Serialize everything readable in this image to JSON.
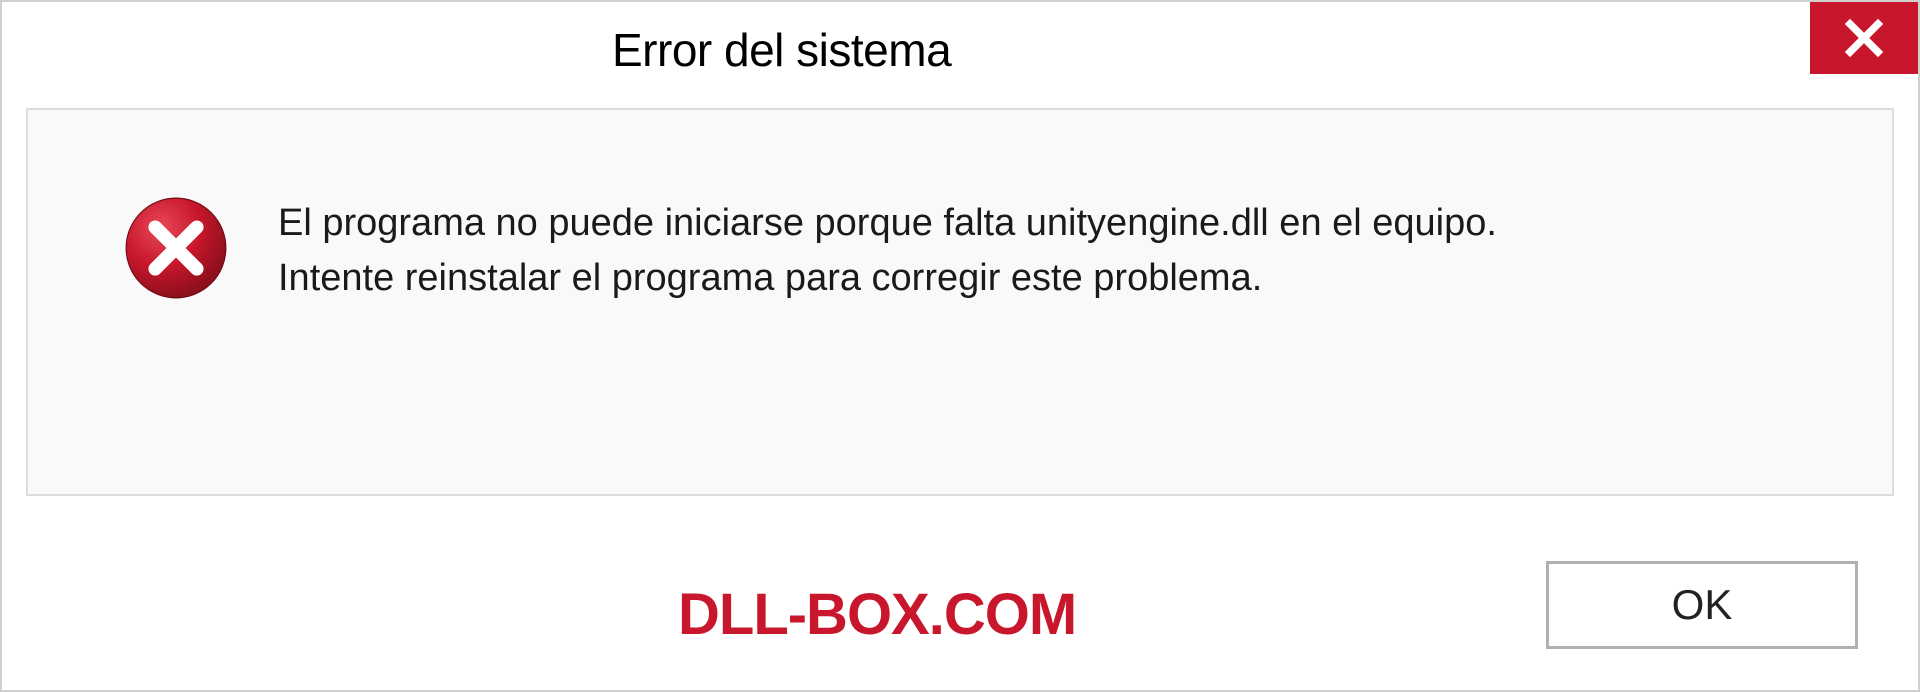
{
  "dialog": {
    "title": "Error del sistema",
    "message_line1": "El programa no puede iniciarse porque falta unityengine.dll en el equipo.",
    "message_line2": "Intente reinstalar el programa para corregir este problema.",
    "ok_label": "OK"
  },
  "watermark": "DLL-BOX.COM",
  "colors": {
    "close_red": "#c8172c",
    "error_red": "#c8172c",
    "watermark_red": "#c8172c"
  }
}
